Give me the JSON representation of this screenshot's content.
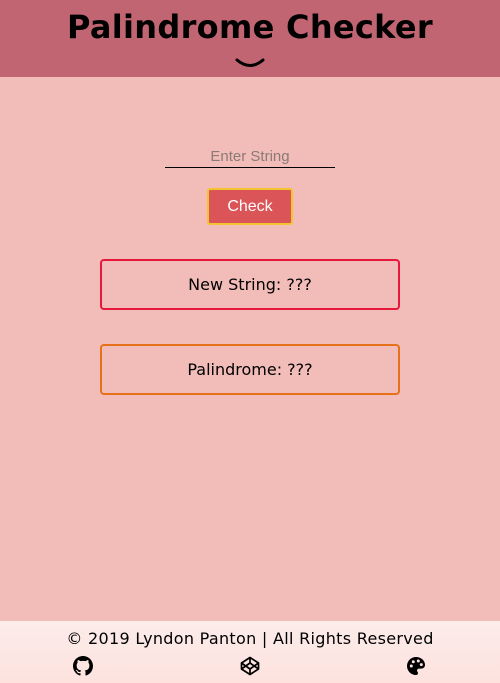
{
  "header": {
    "title": "Palindrome Checker",
    "chevron_icon": "chevron-down-icon"
  },
  "form": {
    "input_placeholder": "Enter String",
    "input_value": "",
    "check_label": "Check"
  },
  "results": {
    "new_string": "New String: ???",
    "palindrome": "Palindrome: ???"
  },
  "footer": {
    "copyright": "© 2019 Lyndon Panton | All Rights Reserved",
    "icons": [
      "github-icon",
      "codepen-icon",
      "palette-icon"
    ]
  },
  "colors": {
    "header_bg": "#c26572",
    "page_bg": "#f2bdb8",
    "button_bg": "#db5457",
    "button_border": "#f4c430",
    "box_new_border": "#e8183c",
    "box_pal_border": "#e7701a"
  }
}
